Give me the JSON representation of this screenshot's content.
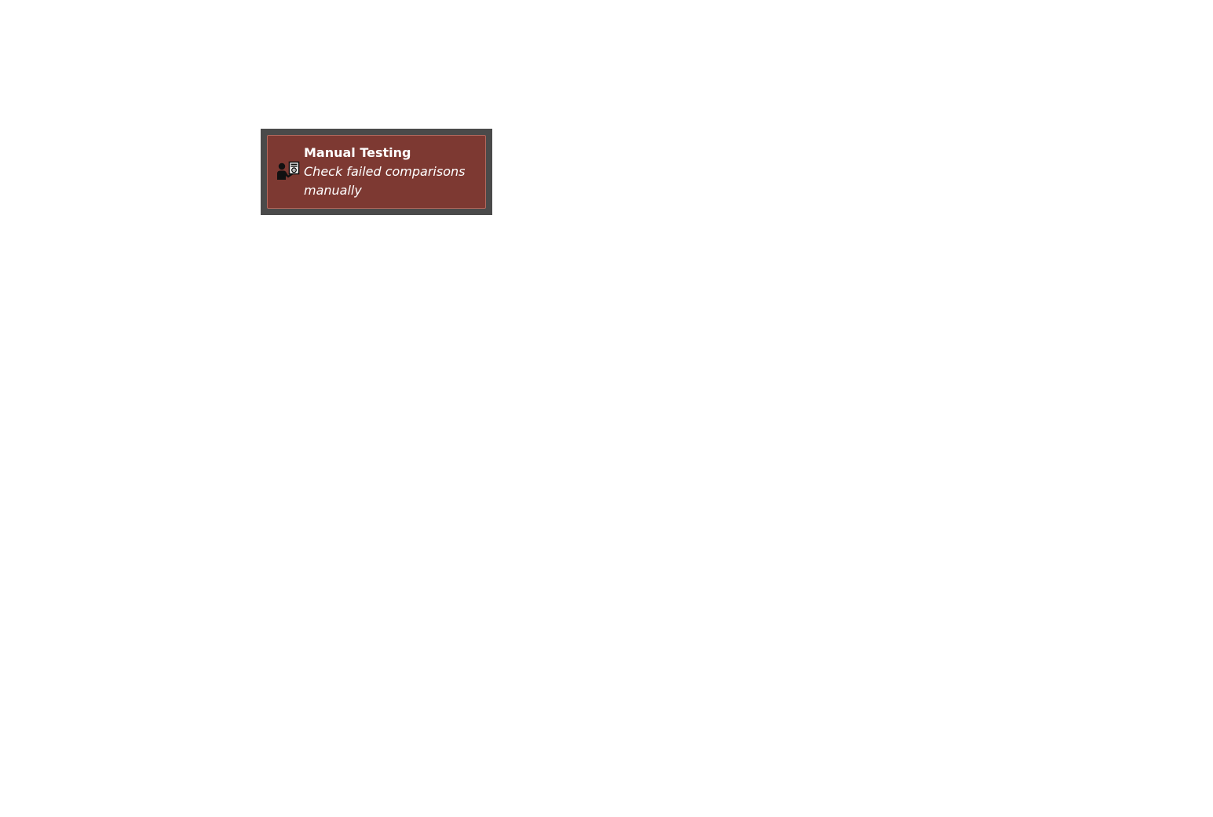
{
  "tile": {
    "title": "Manual Testing",
    "subtitle": "Check failed comparisons manually",
    "icon": "person-with-document-icon",
    "background_color": "#7d3932",
    "frame_color": "#4a4a4a"
  }
}
